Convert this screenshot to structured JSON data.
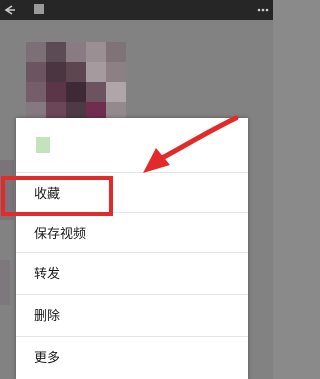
{
  "icons": {
    "back": "arrow-left-icon",
    "more": "more-options-icon"
  },
  "menu": {
    "items": [
      {
        "label": "收藏"
      },
      {
        "label": "保存视频"
      },
      {
        "label": "转发"
      },
      {
        "label": "删除"
      },
      {
        "label": "更多"
      }
    ]
  },
  "colors": {
    "highlight": "#e22a2a",
    "menu_bg": "#ffffff",
    "topbar": "#262626"
  }
}
